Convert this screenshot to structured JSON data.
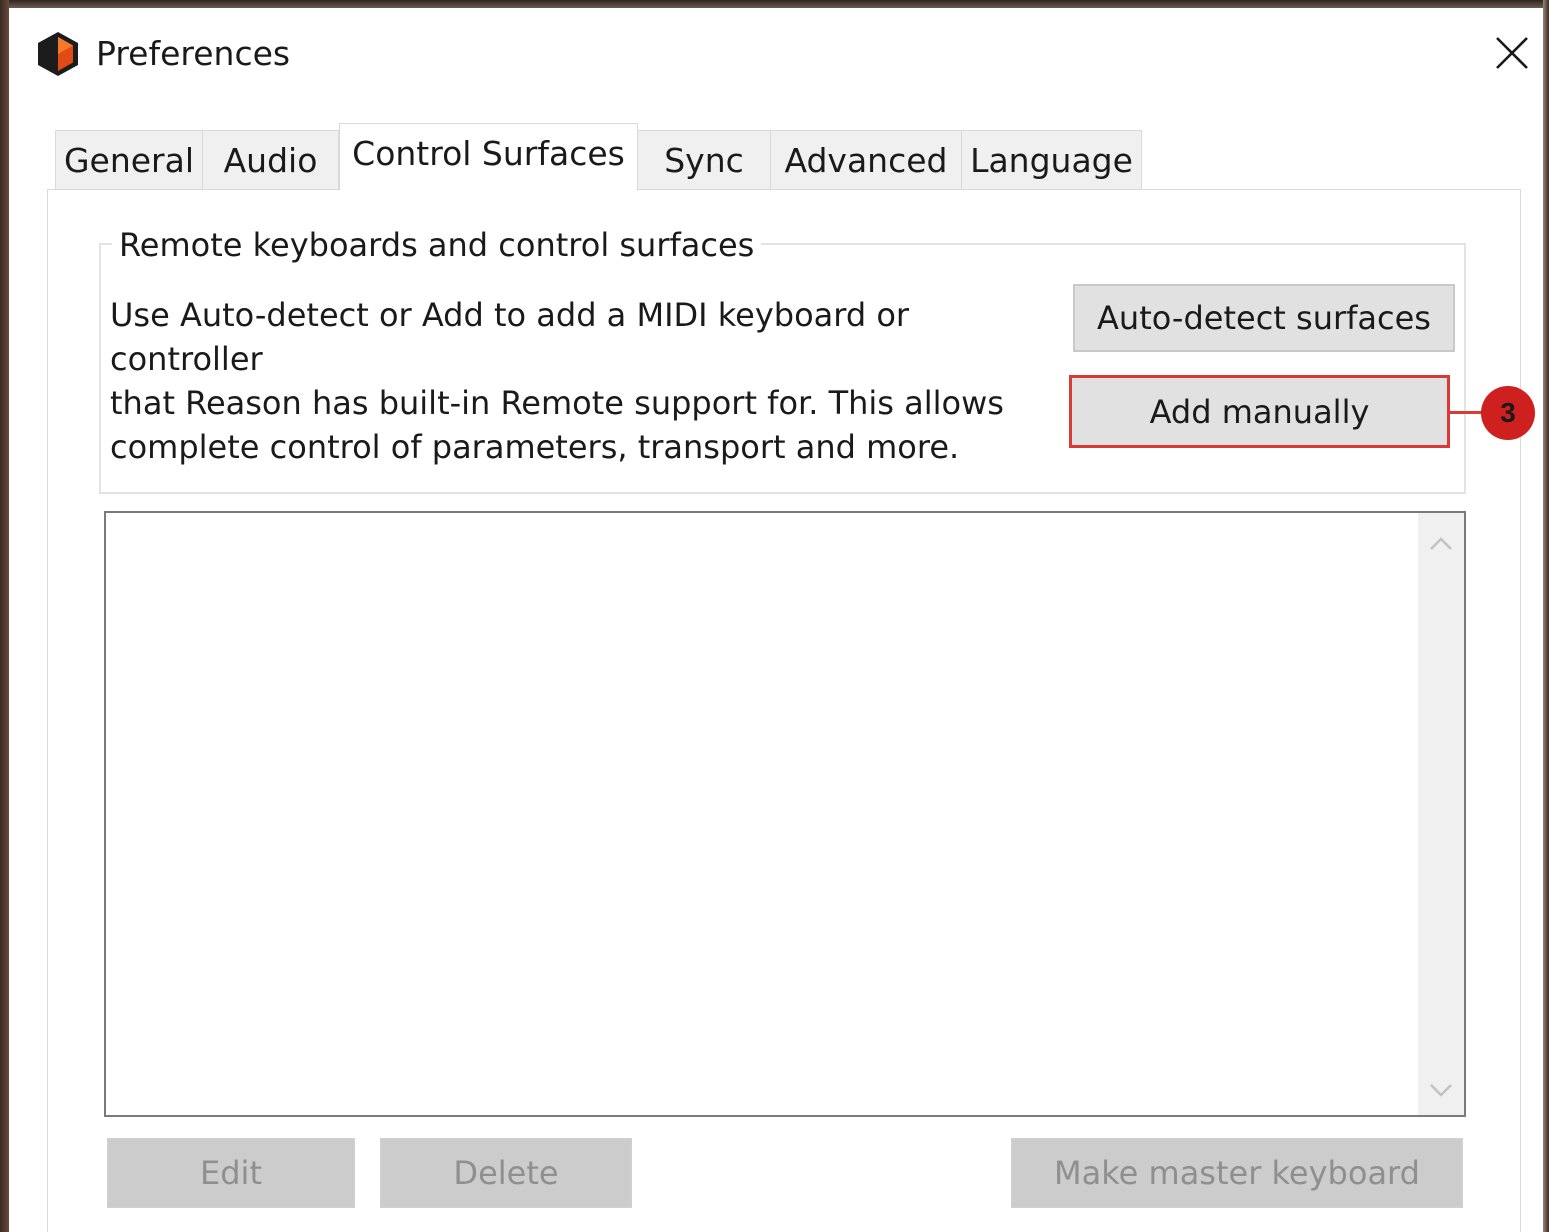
{
  "window": {
    "title": "Preferences",
    "icon": "reason-app-icon",
    "close_icon": "close-icon"
  },
  "tabs": [
    {
      "label": "General",
      "active": false
    },
    {
      "label": "Audio",
      "active": false
    },
    {
      "label": "Control Surfaces",
      "active": true
    },
    {
      "label": "Sync",
      "active": false
    },
    {
      "label": "Advanced",
      "active": false
    },
    {
      "label": "Language",
      "active": false
    }
  ],
  "group": {
    "title": "Remote keyboards and control surfaces",
    "description_lines": [
      "Use Auto-detect or Add to add a MIDI keyboard or controller",
      "that Reason has built-in Remote support for. This allows",
      "complete control of parameters, transport and more."
    ],
    "auto_detect_label": "Auto-detect surfaces",
    "add_manually_label": "Add manually"
  },
  "callout": {
    "number": "3",
    "color": "#d93a36"
  },
  "surfaces_list": {
    "items": [],
    "scroll_up_icon": "chevron-up-icon",
    "scroll_down_icon": "chevron-down-icon"
  },
  "footer": {
    "edit_label": "Edit",
    "delete_label": "Delete",
    "make_master_label": "Make master keyboard"
  }
}
